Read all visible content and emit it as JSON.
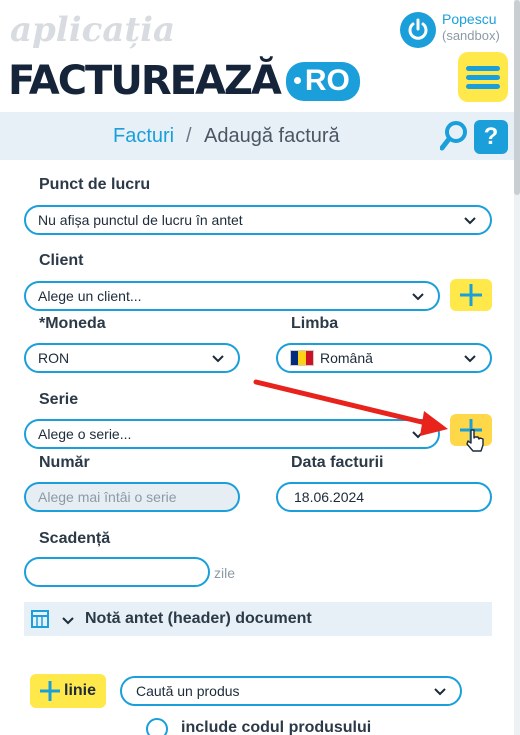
{
  "app": {
    "watermark": "aplicația",
    "logo_main": "FACTUREAZĂ",
    "logo_badge": "RO"
  },
  "user": {
    "name": "Popescu",
    "environment": "(sandbox)"
  },
  "breadcrumb": {
    "parent": "Facturi",
    "separator": "/",
    "current": "Adaugă factură"
  },
  "help_label": "?",
  "form": {
    "work_point": {
      "label": "Punct de lucru",
      "value": "Nu afișa punctul de lucru în antet"
    },
    "client": {
      "label": "Client",
      "value": "Alege un client..."
    },
    "currency": {
      "label": "*Moneda",
      "value": "RON"
    },
    "language": {
      "label": "Limba",
      "value": "Română"
    },
    "series": {
      "label": "Serie",
      "value": "Alege o serie..."
    },
    "number": {
      "label": "Număr",
      "placeholder": "Alege mai întâi o serie"
    },
    "invoice_date": {
      "label": "Data facturii",
      "value": "18.06.2024"
    },
    "due": {
      "label": "Scadență",
      "value": "",
      "unit": "zile"
    }
  },
  "header_note": {
    "label": "Notă antet (header) document"
  },
  "lines": {
    "add_label": "linie",
    "product_search": "Caută un produs",
    "include_code_label": "include codul produsului"
  },
  "colors": {
    "accent": "#1a9fdb",
    "yellow": "#ffe84a",
    "annotation_arrow": "#e8231c"
  }
}
